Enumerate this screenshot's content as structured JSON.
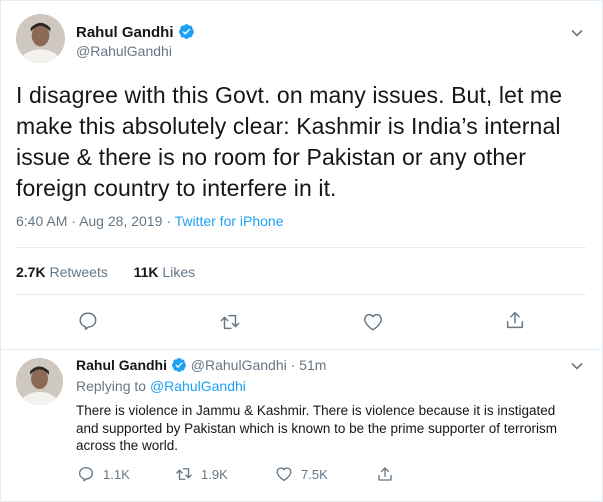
{
  "main_tweet": {
    "author_name": "Rahul Gandhi",
    "author_handle": "@RahulGandhi",
    "text": "I disagree with this Govt. on many issues. But, let me make this absolutely clear: Kashmir is India’s internal issue & there is no room for Pakistan or any other foreign country to interfere in it.",
    "time": "6:40 AM",
    "date": "Aug 28, 2019",
    "separator": "·",
    "source": "Twitter for iPhone",
    "retweets_count": "2.7K",
    "retweets_label": "Retweets",
    "likes_count": "11K",
    "likes_label": "Likes",
    "actions": [
      "reply-icon",
      "retweet-icon",
      "like-icon",
      "share-icon"
    ]
  },
  "reply_tweet": {
    "author_name": "Rahul Gandhi",
    "author_handle": "@RahulGandhi",
    "dot": "·",
    "age": "51m",
    "replying_label": "Replying to",
    "replying_handle": "@RahulGandhi",
    "text": "There is violence in Jammu & Kashmir. There is violence because it is instigated and supported by Pakistan which is known to be the prime supporter of terrorism across the world.",
    "reply_count": "1.1K",
    "retweet_count": "1.9K",
    "like_count": "7.5K"
  },
  "colors": {
    "accent": "#1da1f2",
    "secondary_text": "#657786",
    "primary_text": "#14171a",
    "divider": "#e6ecf0"
  }
}
